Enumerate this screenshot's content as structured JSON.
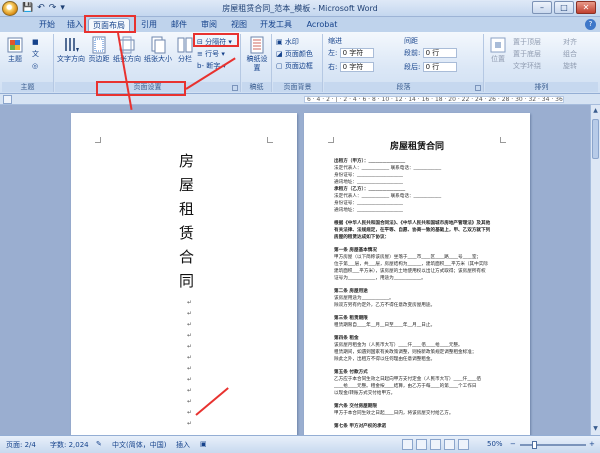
{
  "window": {
    "title": "房屋租赁合同_范本_模板 - Microsoft Word"
  },
  "tabs": [
    "开始",
    "插入",
    "页面布局",
    "引用",
    "邮件",
    "审阅",
    "视图",
    "开发工具",
    "Acrobat"
  ],
  "ribbon": {
    "themes": {
      "label": "主题",
      "theme": "主题",
      "colors": "■",
      "fonts": "文",
      "effects": "◎"
    },
    "page_setup": {
      "label": "页面设置",
      "text_direction": "文字方向",
      "margins": "页边距",
      "orientation": "纸张方向",
      "size": "纸张大小",
      "columns": "分栏",
      "breaks": "分隔符",
      "line_numbers": "行号",
      "hyphenation": "断字"
    },
    "manuscript": {
      "label": "稿纸",
      "button": "稿纸设置"
    },
    "page_background": {
      "label": "页面背景",
      "watermark": "水印",
      "page_color": "页面颜色",
      "page_borders": "页面边框"
    },
    "paragraph": {
      "label": "段落",
      "indent_header": "缩进",
      "spacing_header": "间距",
      "left_label": "左:",
      "left_value": "0 字符",
      "right_label": "右:",
      "right_value": "0 字符",
      "before_label": "段前:",
      "before_value": "0 行",
      "after_label": "段后:",
      "after_value": "0 行"
    },
    "arrange": {
      "label": "排列",
      "position": "位置",
      "bring_front": "置于顶层",
      "send_back": "置于底层",
      "text_wrap": "文字环绕",
      "align": "对齐",
      "group": "组合",
      "rotate": "旋转"
    }
  },
  "ruler": {
    "ticks": "6 · 4 · 2 · | · 2 · 4 · 6 · 8 · 10 · 12 · 14 · 16 · 18 · 20 · 22 · 24 · 26 · 28 · 30 · 32 · 34 · 36 · 38 · | · 42 · 44 · 46 · 48"
  },
  "doc": {
    "cover_title_chars": [
      "房",
      "屋",
      "租",
      "赁",
      "合",
      "同"
    ],
    "page2_title": "房屋租赁合同",
    "page2_lines": [
      {
        "t": "出租方（甲方）：________________",
        "b": true
      },
      {
        "t": "法定代表人：____________  联系电话：____________"
      },
      {
        "t": "身份证号：____________________"
      },
      {
        "t": "通讯地址：____________________"
      },
      {
        "t": "承租方（乙方）：________________",
        "b": true
      },
      {
        "t": "法定代表人：____________  联系电话：____________"
      },
      {
        "t": "身份证号：____________________"
      },
      {
        "t": "通讯地址：____________________"
      },
      {
        "gap": true
      },
      {
        "t": "根据《中华人民共和国合同法》、《中华人民共和国城市房地产管理法》及其他",
        "b": true
      },
      {
        "t": "有关法律、法规规定，在平等、自愿、协商一致的基础上，甲、乙双方就下列",
        "b": true
      },
      {
        "t": "房屋的租赁达成如下协议：",
        "b": true
      },
      {
        "gap": true
      },
      {
        "t": "第一条  房屋基本情况",
        "b": true
      },
      {
        "t": "甲方房屋（以下简称该房屋）坐落于____市____区____路____号____室；"
      },
      {
        "t": "位于第___层，共___层，房屋结构为______，建筑面积___平方米（其中实际"
      },
      {
        "t": "建筑面积___平方米），该房屋的土地使用权以出让方式取得；该房屋所有权"
      },
      {
        "t": "证号为____________，用途为____________。"
      },
      {
        "gap": true
      },
      {
        "t": "第二条  房屋用途",
        "b": true
      },
      {
        "t": "该房屋用途为____________。"
      },
      {
        "t": "除双方另有约定外，乙方不得任意改变房屋用途。"
      },
      {
        "gap": true
      },
      {
        "t": "第三条  租赁期限",
        "b": true
      },
      {
        "t": "租赁期限自____年__月__日至____年__月__日止。"
      },
      {
        "gap": true
      },
      {
        "t": "第四条  租金",
        "b": true
      },
      {
        "t": "该房屋月租金为（人民币大写）____仟____佰____拾____元整。"
      },
      {
        "t": "租赁期间，如遇到国家有关政策调整，则按新政策规定调整租金标准；"
      },
      {
        "t": "除此之外，出租方不得以任何理由任意调整租金。"
      },
      {
        "gap": true
      },
      {
        "t": "第五条  付款方式",
        "b": true
      },
      {
        "t": "乙方应于本合同生效之日起向甲方支付定金（人民币大写）____仟____佰"
      },
      {
        "t": "____拾____元整。租金按____结算，由乙方于每____的第____个工作日"
      },
      {
        "t": "以现金/转账方式交付给甲方。"
      },
      {
        "gap": true
      },
      {
        "t": "第六条  交付房屋期限",
        "b": true
      },
      {
        "t": "甲方于本合同生效之日起____日内，将该房屋交付给乙方。"
      },
      {
        "gap": true
      },
      {
        "t": "第七条  甲方对产权的承诺",
        "b": true
      }
    ]
  },
  "status": {
    "page": "页面: 2/4",
    "words": "字数: 2,024",
    "language": "中文(简体，中国)",
    "mode": "插入",
    "zoom": "50%",
    "zoom_minus": "−",
    "zoom_plus": "+"
  },
  "colors": {
    "annotation_red": "#e8322f",
    "ribbon_bg": "#dbe7f6",
    "frame": "#bfd3ec"
  }
}
